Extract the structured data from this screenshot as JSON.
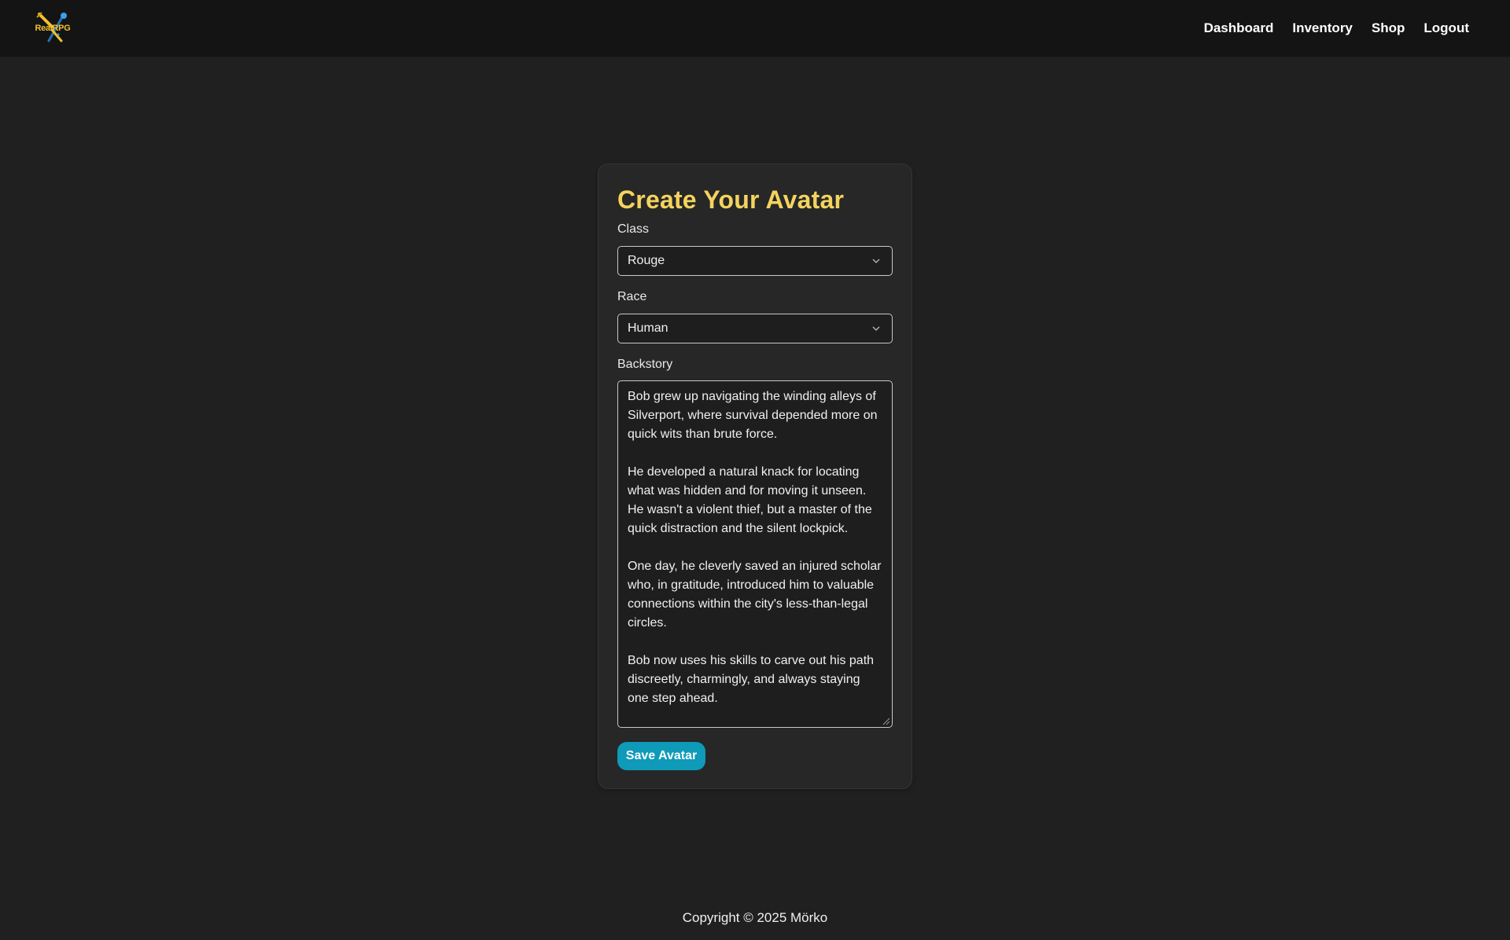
{
  "header": {
    "logo_text": "RealRPG",
    "nav": [
      {
        "label": "Dashboard"
      },
      {
        "label": "Inventory"
      },
      {
        "label": "Shop"
      },
      {
        "label": "Logout"
      }
    ]
  },
  "form": {
    "title": "Create Your Avatar",
    "class": {
      "label": "Class",
      "value": "Rouge"
    },
    "race": {
      "label": "Race",
      "value": "Human"
    },
    "backstory": {
      "label": "Backstory",
      "paragraphs": [
        "Bob grew up navigating the winding alleys of Silverport, where survival depended more on quick wits than brute force.",
        "He developed a natural knack for locating what was hidden and for moving it unseen. He wasn't a violent thief, but a master of the quick distraction and the silent lockpick.",
        "One day, he cleverly saved an injured scholar who, in gratitude, introduced him to valuable connections within the city's less-than-legal circles.",
        "Bob now uses his skills to carve out his path discreetly, charmingly, and always staying one step ahead."
      ]
    },
    "save_label": "Save Avatar"
  },
  "footer": {
    "copyright": "Copyright © 2025 Mörko"
  },
  "colors": {
    "background": "#202020",
    "topbar": "#141414",
    "card": "#272727",
    "title_accent": "#f4d35e",
    "button": "#0e9ab8",
    "logo_accent": "#f2c12e"
  },
  "icons": {
    "logo": "crossed-sword-and-wand-logo",
    "select_indicator": "chevron-down-icon",
    "resize": "resize-grip-icon"
  }
}
